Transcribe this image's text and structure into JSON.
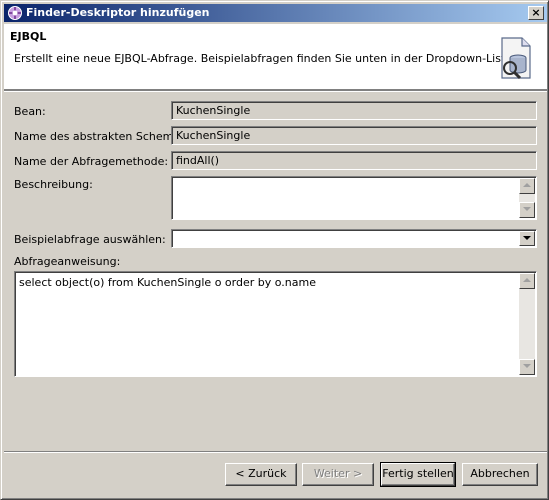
{
  "window": {
    "title": "Finder-Deskriptor hinzufügen",
    "close_glyph": "×"
  },
  "banner": {
    "title": "EJBQL",
    "description": "Erstellt eine neue EJBQL-Abfrage.  Beispielabfragen finden Sie unten in der Dropdown-Liste.",
    "icon": "database-query-icon"
  },
  "form": {
    "bean_label": "Bean:",
    "bean_value": "KuchenSingle",
    "schema_label": "Name des abstrakten Schemas:",
    "schema_value": "KuchenSingle",
    "method_label": "Name der Abfragemethode:",
    "method_value": "findAll()",
    "description_label": "Beschreibung:",
    "description_value": "",
    "example_label": "Beispielabfrage auswählen:",
    "example_value": "",
    "statement_label": "Abfrageanweisung:",
    "statement_value": "select object(o) from KuchenSingle o order by o.name"
  },
  "buttons": {
    "back": "< Zurück",
    "next": "Weiter >",
    "finish": "Fertig stellen",
    "cancel": "Abbrechen"
  }
}
